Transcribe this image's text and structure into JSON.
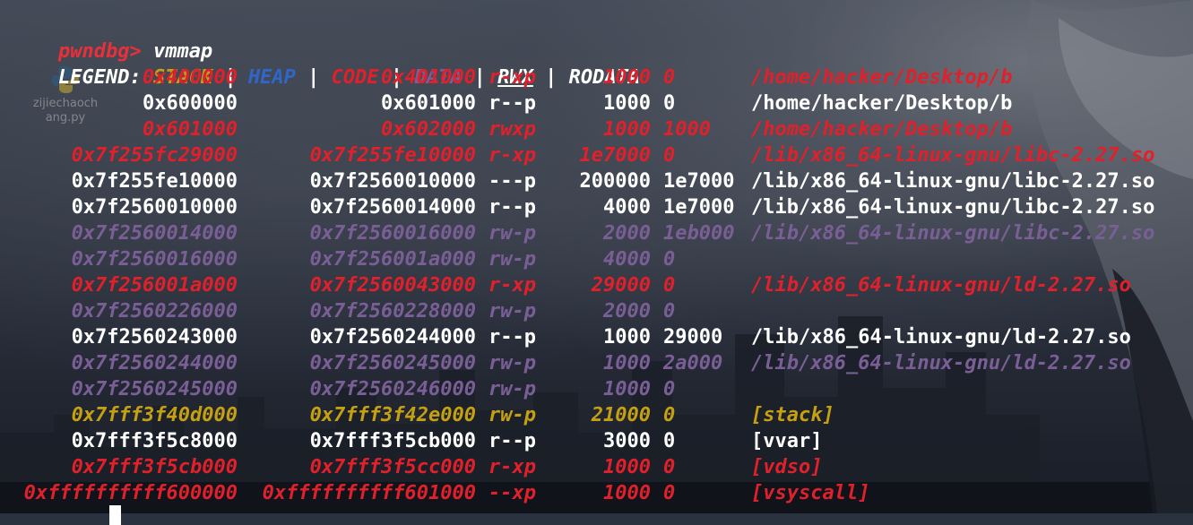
{
  "terminal": {
    "prompt": "pwndbg>",
    "command": "vmmap",
    "legend": {
      "label": "LEGEND:",
      "stack": "STACK",
      "heap": "HEAP",
      "code": "CODE",
      "data": "DATA",
      "rwx": "RWX",
      "rodata": "RODATA",
      "sep": "|"
    },
    "rows": [
      {
        "start": "0x400000",
        "end": "0x401000",
        "perm": "r-xp",
        "size": "1000",
        "offset": "0",
        "path": "/home/hacker/Desktop/b",
        "kind": "code"
      },
      {
        "start": "0x600000",
        "end": "0x601000",
        "perm": "r--p",
        "size": "1000",
        "offset": "0",
        "path": "/home/hacker/Desktop/b",
        "kind": "rodata"
      },
      {
        "start": "0x601000",
        "end": "0x602000",
        "perm": "rwxp",
        "size": "1000",
        "offset": "1000",
        "path": "/home/hacker/Desktop/b",
        "kind": "rwx"
      },
      {
        "start": "0x7f255fc29000",
        "end": "0x7f255fe10000",
        "perm": "r-xp",
        "size": "1e7000",
        "offset": "0",
        "path": "/lib/x86_64-linux-gnu/libc-2.27.so",
        "kind": "code"
      },
      {
        "start": "0x7f255fe10000",
        "end": "0x7f2560010000",
        "perm": "---p",
        "size": "200000",
        "offset": "1e7000",
        "path": "/lib/x86_64-linux-gnu/libc-2.27.so",
        "kind": "rodata"
      },
      {
        "start": "0x7f2560010000",
        "end": "0x7f2560014000",
        "perm": "r--p",
        "size": "4000",
        "offset": "1e7000",
        "path": "/lib/x86_64-linux-gnu/libc-2.27.so",
        "kind": "rodata"
      },
      {
        "start": "0x7f2560014000",
        "end": "0x7f2560016000",
        "perm": "rw-p",
        "size": "2000",
        "offset": "1eb000",
        "path": "/lib/x86_64-linux-gnu/libc-2.27.so",
        "kind": "data"
      },
      {
        "start": "0x7f2560016000",
        "end": "0x7f256001a000",
        "perm": "rw-p",
        "size": "4000",
        "offset": "0",
        "path": "",
        "kind": "data"
      },
      {
        "start": "0x7f256001a000",
        "end": "0x7f2560043000",
        "perm": "r-xp",
        "size": "29000",
        "offset": "0",
        "path": "/lib/x86_64-linux-gnu/ld-2.27.so",
        "kind": "code"
      },
      {
        "start": "0x7f2560226000",
        "end": "0x7f2560228000",
        "perm": "rw-p",
        "size": "2000",
        "offset": "0",
        "path": "",
        "kind": "data"
      },
      {
        "start": "0x7f2560243000",
        "end": "0x7f2560244000",
        "perm": "r--p",
        "size": "1000",
        "offset": "29000",
        "path": "/lib/x86_64-linux-gnu/ld-2.27.so",
        "kind": "rodata"
      },
      {
        "start": "0x7f2560244000",
        "end": "0x7f2560245000",
        "perm": "rw-p",
        "size": "1000",
        "offset": "2a000",
        "path": "/lib/x86_64-linux-gnu/ld-2.27.so",
        "kind": "data"
      },
      {
        "start": "0x7f2560245000",
        "end": "0x7f2560246000",
        "perm": "rw-p",
        "size": "1000",
        "offset": "0",
        "path": "",
        "kind": "data"
      },
      {
        "start": "0x7fff3f40d000",
        "end": "0x7fff3f42e000",
        "perm": "rw-p",
        "size": "21000",
        "offset": "0",
        "path": "[stack]",
        "kind": "stack"
      },
      {
        "start": "0x7fff3f5c8000",
        "end": "0x7fff3f5cb000",
        "perm": "r--p",
        "size": "3000",
        "offset": "0",
        "path": "[vvar]",
        "kind": "rodata"
      },
      {
        "start": "0x7fff3f5cb000",
        "end": "0x7fff3f5cc000",
        "perm": "r-xp",
        "size": "1000",
        "offset": "0",
        "path": "[vdso]",
        "kind": "code"
      },
      {
        "start": "0xffffffffff600000",
        "end": "0xffffffffff601000",
        "perm": "--xp",
        "size": "1000",
        "offset": "0",
        "path": "[vsyscall]",
        "kind": "code"
      }
    ]
  },
  "desktop": {
    "icons": [
      {
        "label": "zijiechaoch ang.py",
        "icon": "python-file-icon"
      }
    ]
  },
  "colors": {
    "code": "#e0202a",
    "stack": "#c4a012",
    "heap": "#2f66c8",
    "data": "#7a5e96",
    "rodata": "#ffffff"
  }
}
